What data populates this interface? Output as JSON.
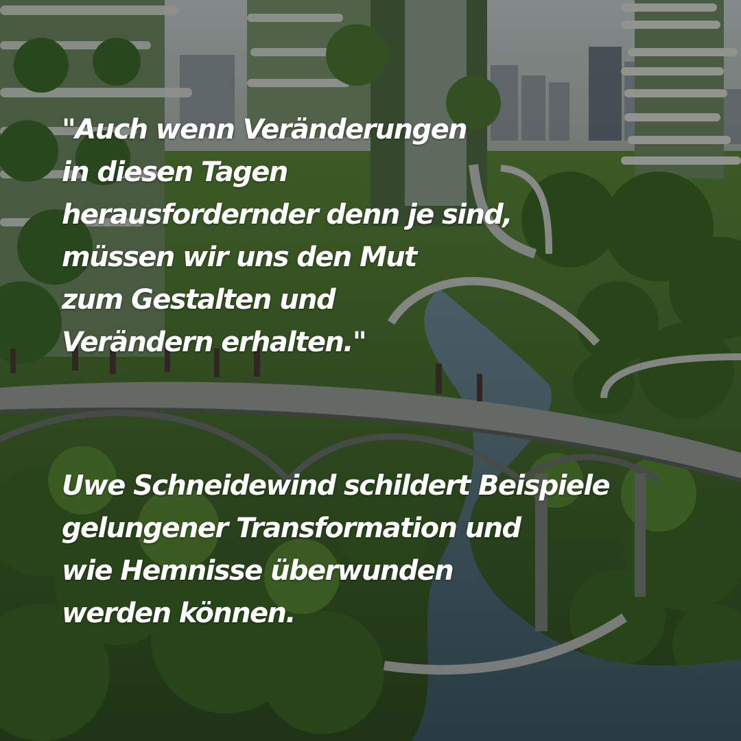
{
  "quote": {
    "lines": [
      "\"Auch wenn Veränderungen",
      "in diesen Tagen",
      "herausfordernder denn je sind,",
      "müssen wir uns den Mut",
      "zum Gestalten und",
      "Verändern erhalten.\""
    ]
  },
  "caption": {
    "lines": [
      "Uwe Schneidewind schildert Beispiele",
      "gelungener Transformation und",
      "wie Hemnisse überwunden",
      "werden können."
    ]
  },
  "colors": {
    "text": "#ffffff",
    "overlay": "rgba(0,0,0,0.34)",
    "foliage": "#3f6b2a",
    "water": "#44646e",
    "sky": "#bcc6c9"
  }
}
